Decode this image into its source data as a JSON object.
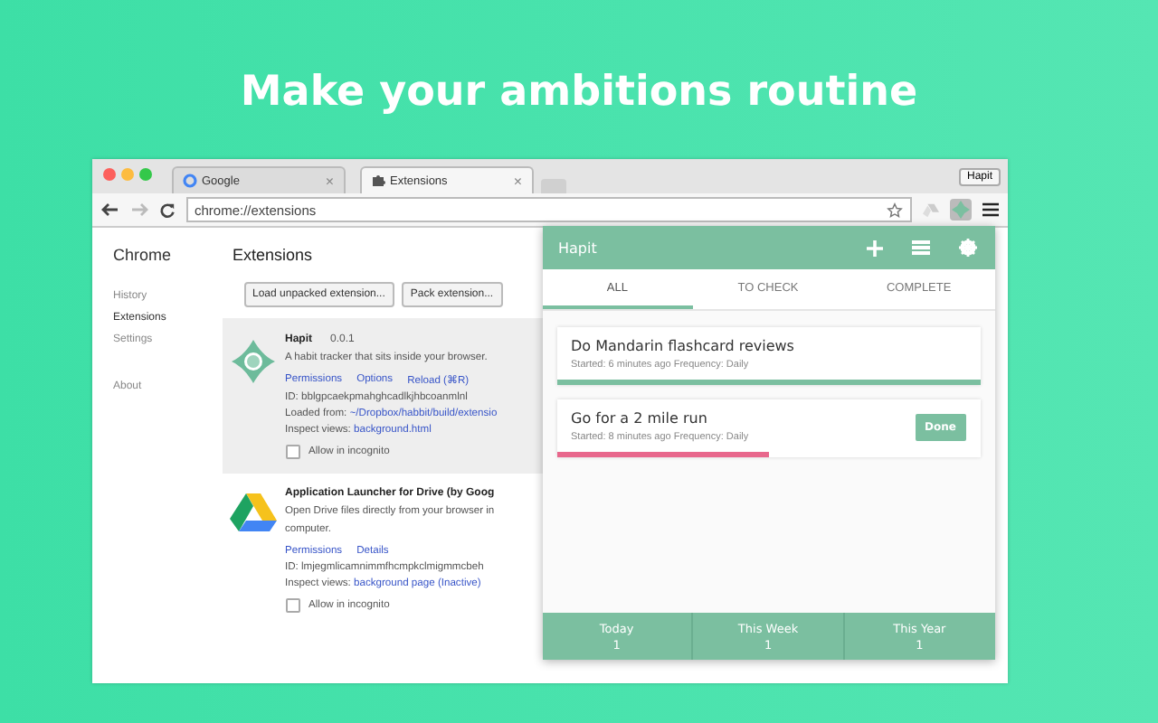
{
  "headline": "Make your ambitions routine",
  "browser": {
    "tabs": [
      {
        "label": "Google",
        "close": "×",
        "selected": false
      },
      {
        "label": "Extensions",
        "close": "×",
        "selected": true
      }
    ],
    "profile": "Hapit",
    "url": "chrome://extensions"
  },
  "sidebar": {
    "title": "Chrome",
    "items": [
      {
        "label": "History",
        "selected": false
      },
      {
        "label": "Extensions",
        "selected": true
      },
      {
        "label": "Settings",
        "selected": false
      },
      {
        "label": "About",
        "selected": false
      }
    ]
  },
  "extensions": {
    "title": "Extensions",
    "buttons": [
      "Load unpacked extension...",
      "Pack extension..."
    ],
    "items": [
      {
        "name": "Hapit",
        "version": "0.0.1",
        "description": "A habit tracker that sits inside your browser.",
        "links": [
          "Permissions",
          "Options",
          "Reload (⌘R)"
        ],
        "id": "ID: bblgpcaekpmahghcadlkjhbcoanmlnl",
        "loaded_label": "Loaded from:",
        "loaded_path": "~/Dropbox/habbit/build/extensio",
        "inspect_label": "Inspect views:",
        "inspect_link": "background.html",
        "incognito": "Allow in incognito",
        "highlighted": true
      },
      {
        "name": "Application Launcher for Drive (by Goog",
        "description": "Open Drive files directly from your browser in computer.",
        "links": [
          "Permissions",
          "Details"
        ],
        "id": "ID: lmjegmlicamnimmfhcmpkclmigmmcbeh",
        "inspect_label": "Inspect views:",
        "inspect_link": "background page (Inactive)",
        "incognito": "Allow in incognito",
        "highlighted": false
      }
    ]
  },
  "popup": {
    "title": "Hapit",
    "tabs": [
      {
        "label": "ALL",
        "selected": true
      },
      {
        "label": "TO CHECK",
        "selected": false
      },
      {
        "label": "COMPLETE",
        "selected": false
      }
    ],
    "habits": [
      {
        "title": "Do Mandarin flashcard reviews",
        "meta": "Started: 6 minutes ago  Frequency: Daily",
        "level": 1,
        "color": "#7bbfa0"
      },
      {
        "title": "Go for a 2 mile run",
        "meta": "Started: 8 minutes ago  Frequency: Daily",
        "level": 0.5,
        "color": "#e8678c",
        "button": "Done"
      }
    ],
    "stats": [
      {
        "label": "Today",
        "value": "1"
      },
      {
        "label": "This Week",
        "value": "1"
      },
      {
        "label": "This Year",
        "value": "1"
      }
    ]
  }
}
